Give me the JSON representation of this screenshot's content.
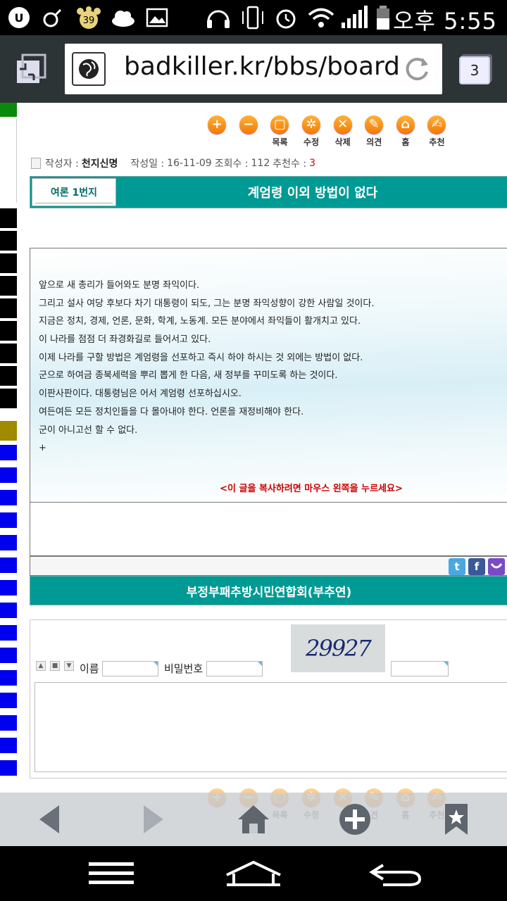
{
  "status_bar": {
    "time": "오후 5:55",
    "notification_badge": "39",
    "icons": [
      "u-plus-icon",
      "male-icon",
      "paw-badge-icon",
      "cloud-icon",
      "image-icon",
      "headset-icon",
      "vibrate-icon",
      "alarm-icon",
      "wifi-icon",
      "signal-icon",
      "battery-icon"
    ]
  },
  "browser": {
    "url": "badkiller.kr/bbs/board.p",
    "tab_count": "3"
  },
  "toolbar": {
    "items": [
      {
        "label": "",
        "symbol": "+",
        "icon": "plus-icon"
      },
      {
        "label": "",
        "symbol": "−",
        "icon": "minus-icon"
      },
      {
        "label": "목록",
        "symbol": "▢",
        "icon": "list-icon"
      },
      {
        "label": "수정",
        "symbol": "✲",
        "icon": "edit-icon"
      },
      {
        "label": "삭제",
        "symbol": "✕",
        "icon": "delete-icon"
      },
      {
        "label": "의견",
        "symbol": "✎",
        "icon": "comment-icon"
      },
      {
        "label": "홈",
        "symbol": "⌂",
        "icon": "home-icon"
      },
      {
        "label": "추천",
        "symbol": "✍",
        "icon": "recommend-icon"
      }
    ]
  },
  "post_meta": {
    "author_label": "작성자 :",
    "author": "천지신명",
    "date_label": "작성일 :",
    "date": "16-11-09",
    "views_label": "조회수 :",
    "views": "112",
    "recommends_label": "추천수 :",
    "recommends": "3"
  },
  "post": {
    "category": "여론 1번지",
    "title": "계엄령 이외 방법이 없다",
    "body_lines": [
      "앞으로 새 총리가 들어와도 분명 좌익이다.",
      "그리고 설사 여당 후보다 차기 대통령이 되도, 그는 분명 좌익성향이 강한 사람일 것이다.",
      "지금은 정치, 경제, 언론, 문화, 학계, 노동계. 모든 분야에서 좌익들이 활개치고 있다.",
      "이 나라를 점점 더 좌경화길로 들어서고 있다.",
      "이제 나라를 구할 방법은 계엄령을 선포하고 즉시 하야 하시는 것 외에는 방법이 없다.",
      "군으로 하여금 종북세력을 뿌리 뽑게 한 다음, 새 정부를 꾸미도록 하는 것이다.",
      "이판사판이다. 대통령님은 어서 계엄령 선포하십시오.",
      "여든여든 모든 정치인들을 다 몰아내야 한다. 언론을 재정비해야 한다.",
      "군이 아니고선 할 수 없다.",
      "+"
    ],
    "copy_notice": "<이 글을 복사하려면 마우스 왼쪽을 누르세요>"
  },
  "share": {
    "twitter": "t",
    "facebook": "f"
  },
  "org_name": "부정부패추방시민연합회(부추연)",
  "comment_form": {
    "captcha": "29927",
    "name_label": "이름",
    "password_label": "비밀번호"
  },
  "bottom_toolbar": {
    "labels": [
      "목록",
      "수정",
      "삭",
      "견",
      "홈",
      "추천"
    ]
  },
  "colors": {
    "teal": "#009a94",
    "accent_orange": "#f47a00",
    "notice_red": "#cc0000"
  }
}
